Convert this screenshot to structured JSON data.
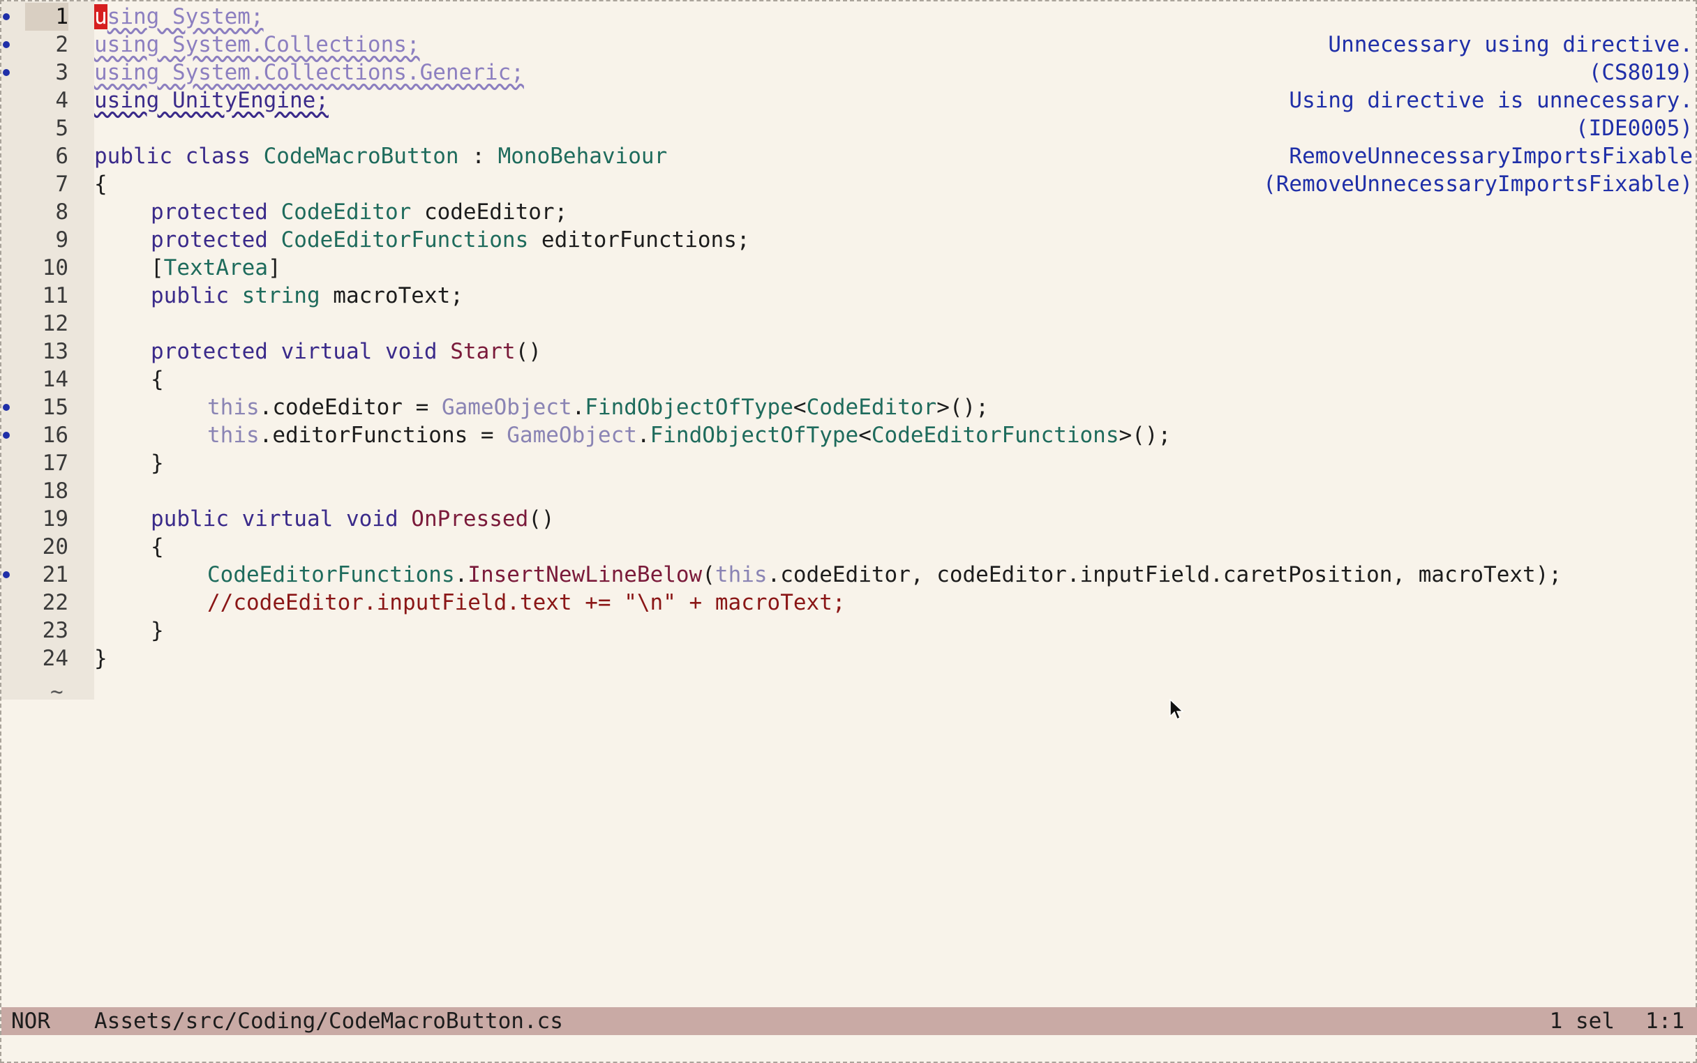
{
  "editor": {
    "line_numbers": [
      "1",
      "2",
      "3",
      "4",
      "5",
      "6",
      "7",
      "8",
      "9",
      "10",
      "11",
      "12",
      "13",
      "14",
      "15",
      "16",
      "17",
      "18",
      "19",
      "20",
      "21",
      "22",
      "23",
      "24"
    ],
    "empty_line_marker": "~",
    "code": {
      "l1_cursor": "u",
      "l1_rest": "sing System;",
      "l2": "using System.Collections;",
      "l3": "using System.Collections.Generic;",
      "l4": "using UnityEngine;",
      "l6_kw": "public class ",
      "l6_name": "CodeMacroButton",
      "l6_sep": " : ",
      "l6_base": "MonoBehaviour",
      "brace_open": "{",
      "brace_close": "}",
      "l8_kw": "protected ",
      "l8_type": "CodeEditor",
      "l8_name": " codeEditor;",
      "l9_kw": "protected ",
      "l9_type": "CodeEditorFunctions",
      "l9_name": " editorFunctions;",
      "l10_open": "[",
      "l10_attr": "TextArea",
      "l10_close": "]",
      "l11_kw": "public ",
      "l11_type": "string",
      "l11_name": " macroText;",
      "l13_kw": "protected virtual void ",
      "l13_fn": "Start",
      "l13_paren": "()",
      "l15_this": "this",
      "l15_mid": ".codeEditor = ",
      "l15_go": "GameObject",
      "l15_dot": ".",
      "l15_fn": "FindObjectOfType",
      "l15_lt": "<",
      "l15_type": "CodeEditor",
      "l15_end": ">();",
      "l16_this": "this",
      "l16_mid": ".editorFunctions = ",
      "l16_go": "GameObject",
      "l16_dot": ".",
      "l16_fn": "FindObjectOfType",
      "l16_lt": "<",
      "l16_type": "CodeEditorFunctions",
      "l16_end": ">();",
      "l19_kw": "public virtual void ",
      "l19_fn": "OnPressed",
      "l19_paren": "()",
      "l21_type": "CodeEditorFunctions",
      "l21_dot": ".",
      "l21_fn": "InsertNewLineBelow",
      "l21_paren": "(",
      "l21_this": "this",
      "l21_args": ".codeEditor, codeEditor.inputField.caretPosition, macroText);",
      "l22_comment": "//codeEditor.inputField.text += \"\\n\" + macroText;"
    }
  },
  "diagnostics": [
    "Unnecessary using directive.",
    "(CS8019)",
    "Using directive is unnecessary.",
    "(IDE0005)",
    "RemoveUnnecessaryImportsFixable",
    "(RemoveUnnecessaryImportsFixable)"
  ],
  "statusbar": {
    "mode": "NOR",
    "file_path": "Assets/src/Coding/CodeMacroButton.cs",
    "selections": "1 sel",
    "cursor_position": "1:1"
  },
  "colors": {
    "background": "#f8f3ea",
    "gutter": "#ece6dc",
    "statusbar": "#c9aaa5",
    "diagnostic": "#1f2fa8",
    "cursor": "#d61f1f"
  }
}
